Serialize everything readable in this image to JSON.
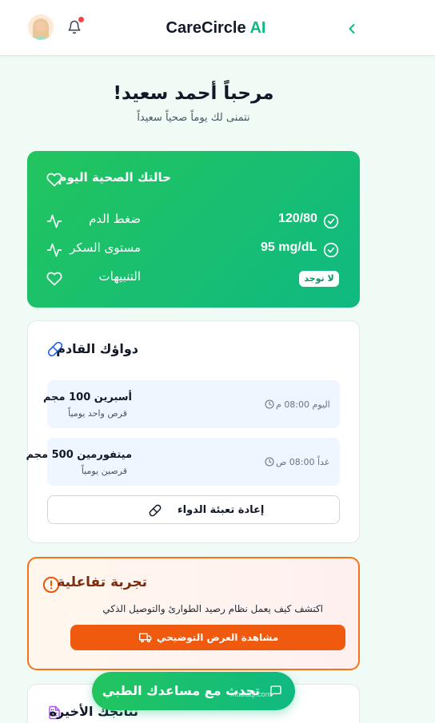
{
  "header": {
    "brand_name": "CareCircle",
    "brand_suffix": "AI"
  },
  "greeting": {
    "title": "مرحباً أحمد سعيد!",
    "subtitle": "نتمنى لك يوماً صحياً سعيداً"
  },
  "health": {
    "title": "حالتك الصحية اليوم",
    "rows": [
      {
        "label": "ضغط الدم",
        "value": "120/80"
      },
      {
        "label": "مستوى السكر",
        "value": "95 mg/dL"
      },
      {
        "label": "التنبيهات",
        "value": "لا توجد"
      }
    ]
  },
  "medications": {
    "title": "دواؤك القادم",
    "items": [
      {
        "name": "أسبرين 100 مجم",
        "dose": "قرص واحد يومياً",
        "time": "اليوم 08:00 م"
      },
      {
        "name": "ميتفورمين 500 مجم",
        "dose": "قرصين يومياً",
        "time": "غداً 08:00 ص"
      }
    ],
    "refill_label": "إعادة تعبئة الدواء"
  },
  "demo": {
    "title": "تجربة تفاعلية",
    "description": "اكتشف كيف يعمل نظام رصيد الطوارئ والتوصيل الذكي",
    "button_label": "مشاهدة العرض التوضيحي"
  },
  "results": {
    "title": "نتائجك الأخيرة"
  },
  "chat": {
    "label": "تحدث مع مساعدك الطبي"
  },
  "watermark": "mostaql.com",
  "colors": {
    "primary": "#10b981",
    "accent": "#f05a0f",
    "alert": "#ef4444"
  }
}
